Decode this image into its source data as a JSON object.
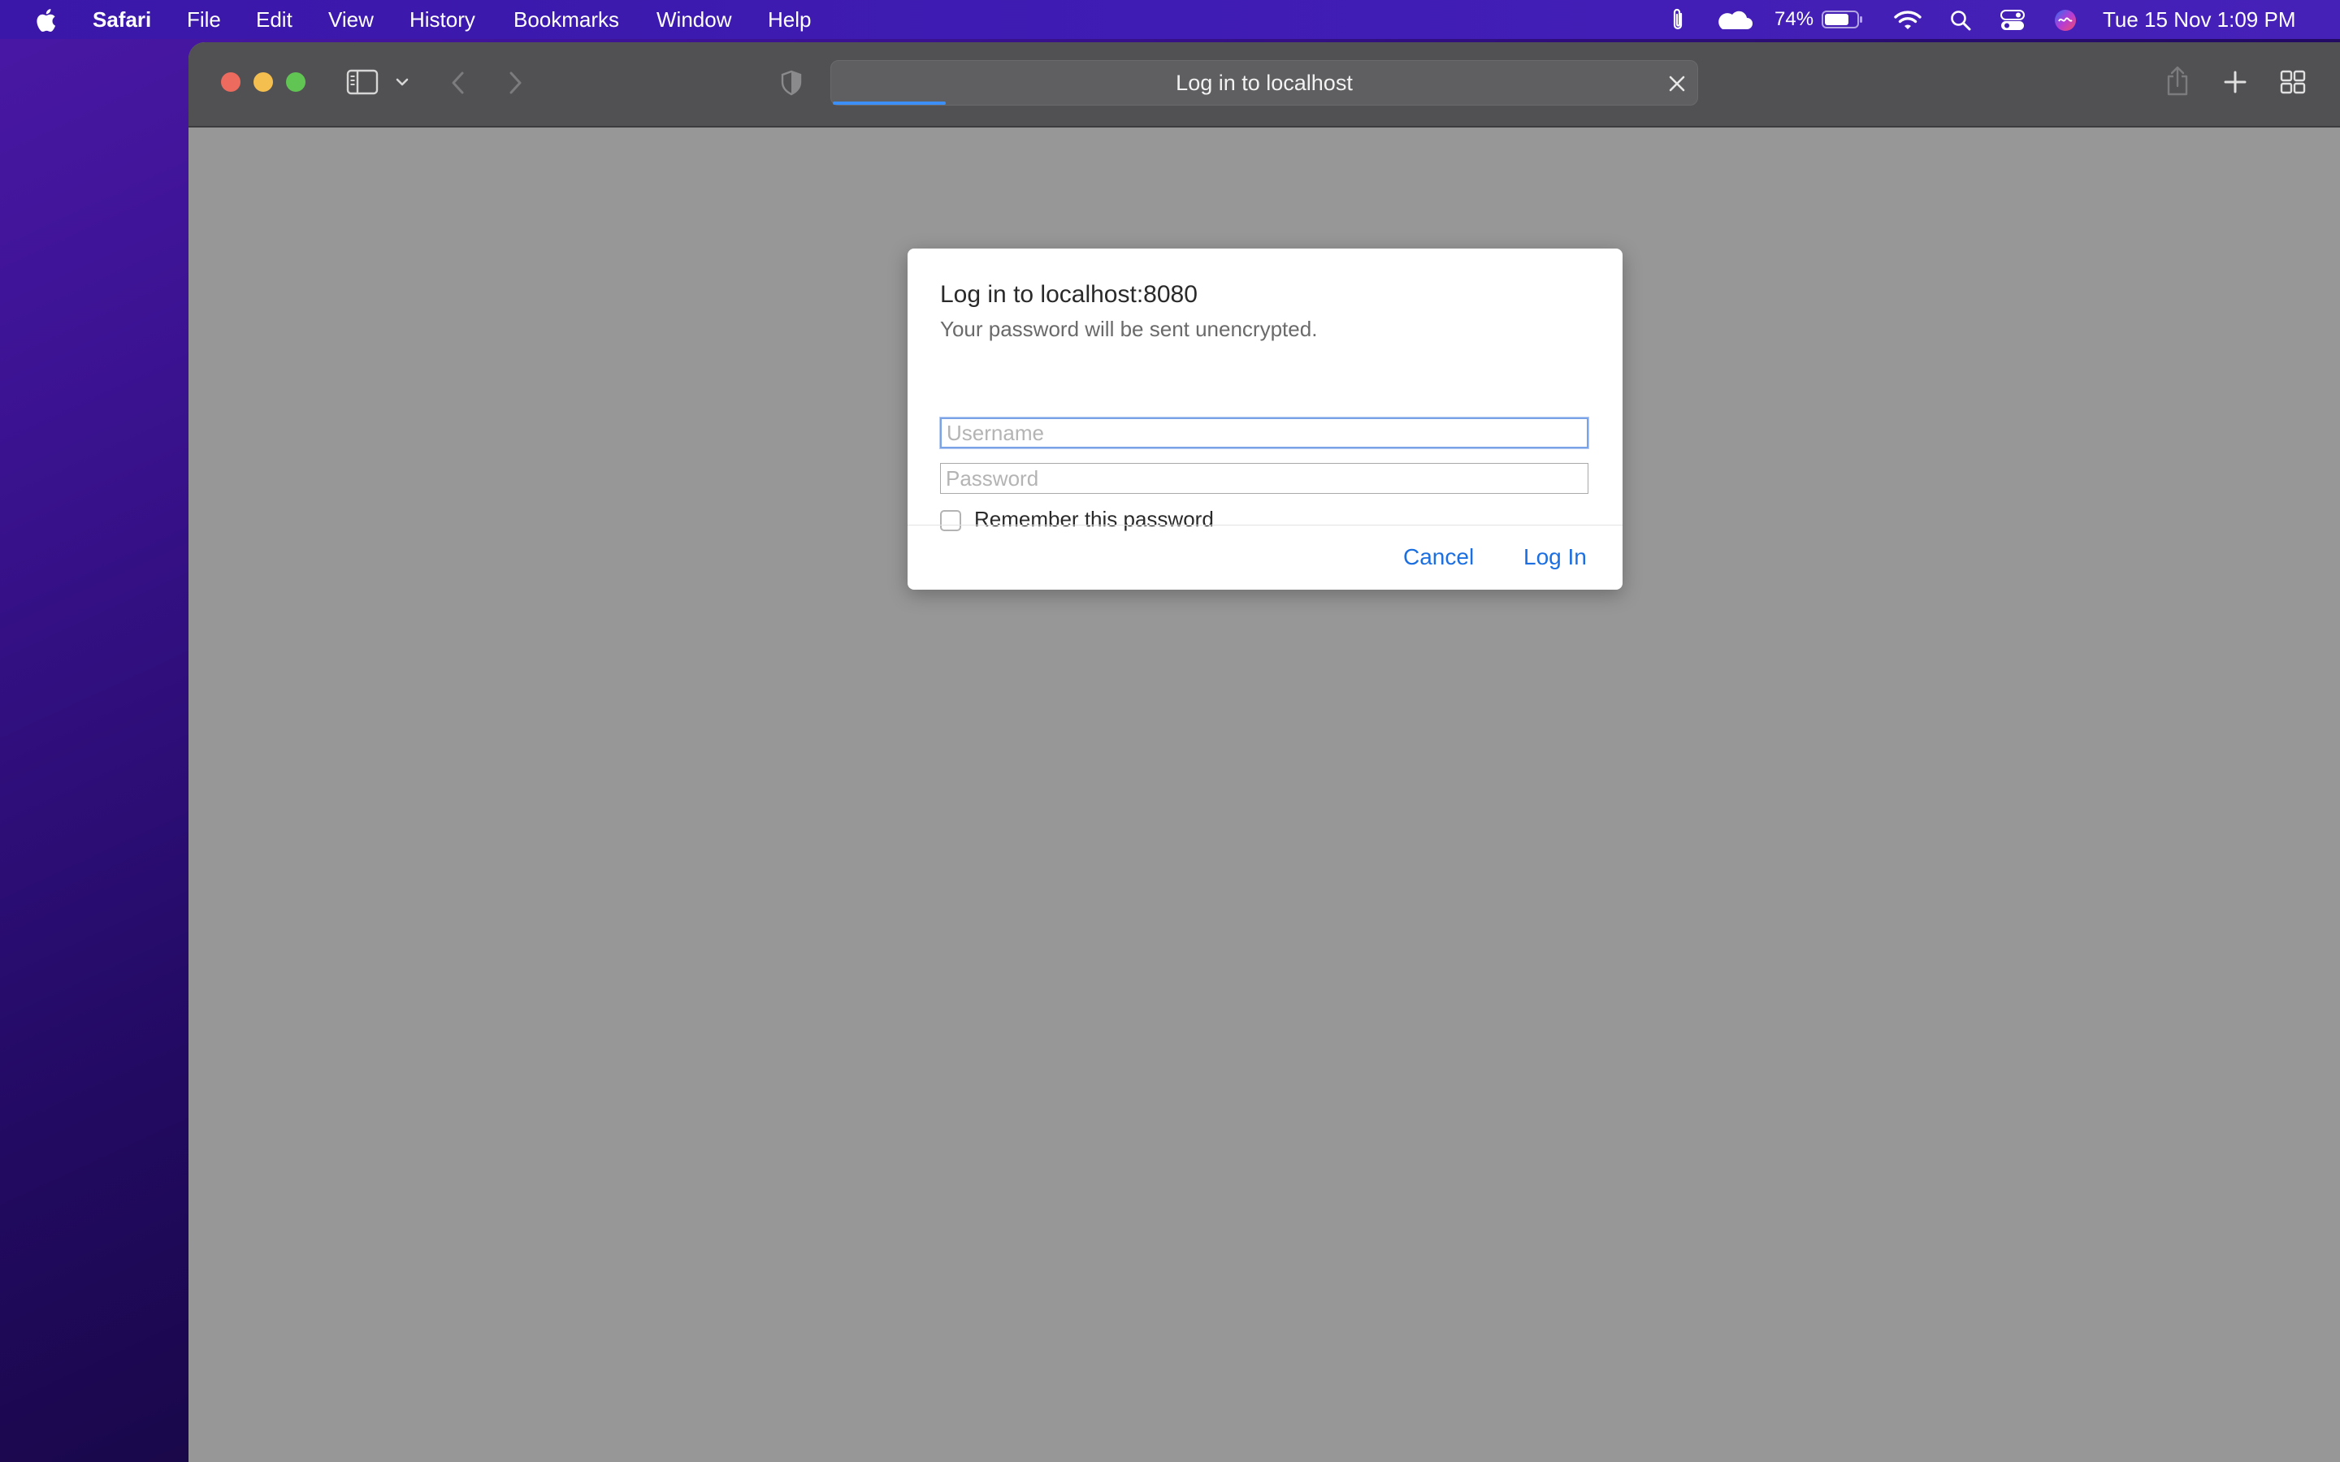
{
  "menubar": {
    "app_name": "Safari",
    "items": [
      "File",
      "Edit",
      "View",
      "History",
      "Bookmarks",
      "Window",
      "Help"
    ],
    "battery_percent": "74%",
    "datetime": "Tue 15 Nov  1:09 PM",
    "status_icons": [
      "paperclip-icon",
      "cloud-icon",
      "battery-icon",
      "wifi-icon",
      "search-icon",
      "control-center-icon",
      "siri-icon"
    ]
  },
  "browser": {
    "tab_title": "Log in to localhost",
    "load_progress": 0.13,
    "toolbar_icons": [
      "sidebar-icon",
      "chevron-down-icon",
      "back-icon",
      "forward-icon",
      "privacy-shield-icon",
      "close-icon",
      "share-icon",
      "plus-icon",
      "tab-overview-icon"
    ]
  },
  "dialog": {
    "title": "Log in to localhost:8080",
    "subtitle": "Your password will be sent unencrypted.",
    "username_placeholder": "Username",
    "password_placeholder": "Password",
    "username_value": "",
    "password_value": "",
    "remember_label": "Remember this password",
    "remember_checked": false,
    "cancel_label": "Cancel",
    "login_label": "Log In"
  },
  "colors": {
    "accent": "#1c6fe0",
    "menubar": "#3f1cb4",
    "titlebar": "#515153",
    "page_background": "#979797"
  }
}
